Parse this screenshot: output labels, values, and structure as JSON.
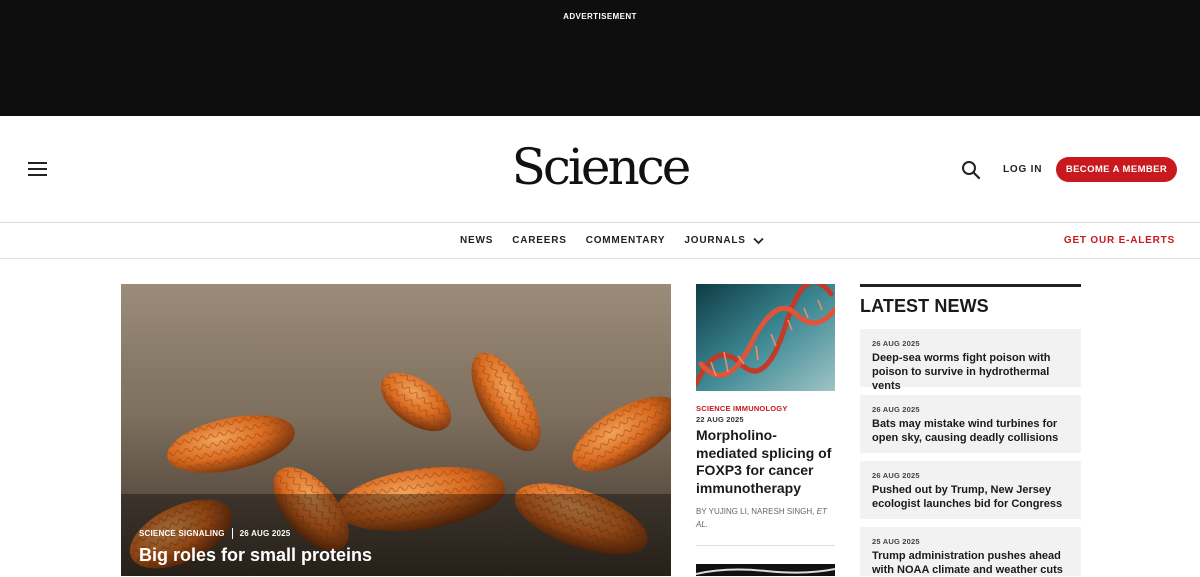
{
  "ad": {
    "label": "ADVERTISEMENT"
  },
  "header": {
    "logo": "Science",
    "login_label": "LOG IN",
    "member_label": "BECOME A MEMBER",
    "accent_color": "#c8191e"
  },
  "nav": {
    "items": [
      {
        "label": "NEWS"
      },
      {
        "label": "CAREERS"
      },
      {
        "label": "COMMENTARY"
      },
      {
        "label": "JOURNALS"
      }
    ],
    "alerts_label": "GET OUR E-ALERTS"
  },
  "hero": {
    "section": "SCIENCE SIGNALING",
    "date": "26 AUG 2025",
    "title": "Big roles for small proteins"
  },
  "feature": {
    "journal": "SCIENCE IMMUNOLOGY",
    "date": "22 AUG 2025",
    "title": "Morpholino-mediated splicing of FOXP3 for cancer immunotherapy",
    "authors_prefix": "BY YUJING LI, NARESH SINGH,",
    "authors_suffix": "ET AL."
  },
  "latest": {
    "heading": "LATEST NEWS",
    "items": [
      {
        "date": "26 AUG 2025",
        "title": "Deep-sea worms fight poison with poison to survive in hydrothermal vents"
      },
      {
        "date": "26 AUG 2025",
        "title": "Bats may mistake wind turbines for open sky, causing deadly collisions"
      },
      {
        "date": "26 AUG 2025",
        "title": "Pushed out by Trump, New Jersey ecologist launches bid for Congress"
      },
      {
        "date": "25 AUG 2025",
        "title": "Trump administration pushes ahead with NOAA climate and weather cuts"
      }
    ]
  }
}
